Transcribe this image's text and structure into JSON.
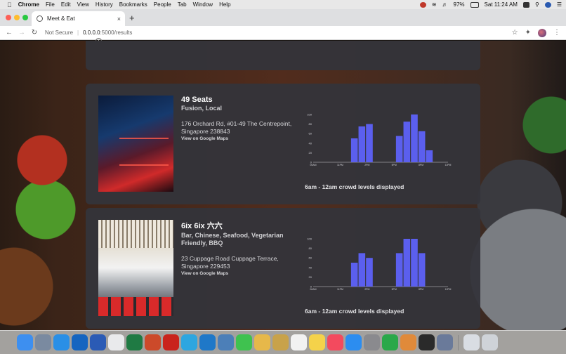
{
  "menubar": {
    "app": "Chrome",
    "items": [
      "File",
      "Edit",
      "View",
      "History",
      "Bookmarks",
      "People",
      "Tab",
      "Window",
      "Help"
    ],
    "battery": "97%",
    "datetime": "Sat 11:24 AM"
  },
  "tab": {
    "title": "Meet & Eat",
    "close": "×",
    "new_tab": "+"
  },
  "toolbar": {
    "security": "Not Secure",
    "url_host": "0.0.0.0",
    "url_path": ":5000/results"
  },
  "restaurants": [
    {
      "name": "49 Seats",
      "cuisine": "Fusion, Local",
      "address": "176 Orchard Rd, #01-49 The Centrepoint, Singapore 238843",
      "map_link": "View on Google Maps",
      "caption": "6am - 12am crowd levels displayed",
      "chart_data": {
        "type": "bar",
        "categories": [
          "6am",
          "7am",
          "8am",
          "9am",
          "10am",
          "11am",
          "12pm",
          "1pm",
          "2pm",
          "3pm",
          "4pm",
          "5pm",
          "6pm",
          "7pm",
          "8pm",
          "9pm",
          "10pm",
          "11pm"
        ],
        "values": [
          0,
          0,
          0,
          0,
          0,
          50,
          75,
          80,
          0,
          0,
          0,
          55,
          85,
          100,
          65,
          25,
          0,
          0
        ],
        "ylim": [
          0,
          100
        ],
        "yticks": [
          "0",
          "20",
          "40",
          "60",
          "80",
          "100"
        ],
        "xticks": [
          "06AM",
          "11PM",
          "2PM",
          "5PM",
          "8PM",
          "11PM"
        ],
        "bar_color": "#5b5fee"
      }
    },
    {
      "name": "6ix 6ix 六六",
      "cuisine": "Bar, Chinese, Seafood, Vegetarian Friendly, BBQ",
      "address": "23 Cuppage Road Cuppage Terrace, Singapore 229453",
      "map_link": "View on Google Maps",
      "caption": "6am - 12am crowd levels displayed",
      "chart_data": {
        "type": "bar",
        "categories": [
          "6am",
          "7am",
          "8am",
          "9am",
          "10am",
          "11am",
          "12pm",
          "1pm",
          "2pm",
          "3pm",
          "4pm",
          "5pm",
          "6pm",
          "7pm",
          "8pm",
          "9pm",
          "10pm",
          "11pm"
        ],
        "values": [
          0,
          0,
          0,
          0,
          0,
          50,
          70,
          60,
          0,
          0,
          0,
          70,
          100,
          100,
          70,
          0,
          0,
          0
        ],
        "ylim": [
          0,
          100
        ],
        "yticks": [
          "0",
          "20",
          "40",
          "60",
          "80",
          "100"
        ],
        "xticks": [
          "06AM",
          "11PM",
          "2PM",
          "5PM",
          "8PM",
          "11PM"
        ],
        "bar_color": "#5b5fee"
      }
    }
  ],
  "dock": {
    "apps": [
      {
        "name": "finder",
        "color": "#3d8ff0"
      },
      {
        "name": "launchpad",
        "color": "#7a8aa0"
      },
      {
        "name": "safari",
        "color": "#2a8fe6"
      },
      {
        "name": "outlook",
        "color": "#1565c0"
      },
      {
        "name": "word",
        "color": "#2b5bb5"
      },
      {
        "name": "chrome",
        "color": "#e9eaec"
      },
      {
        "name": "excel",
        "color": "#1f7a43"
      },
      {
        "name": "powerpoint",
        "color": "#cc4a2a"
      },
      {
        "name": "acrobat",
        "color": "#c9231c"
      },
      {
        "name": "telegram",
        "color": "#2ea6e0"
      },
      {
        "name": "vscode",
        "color": "#1f78c8"
      },
      {
        "name": "preview",
        "color": "#4c7fb8"
      },
      {
        "name": "messages",
        "color": "#3fc24f"
      },
      {
        "name": "photos",
        "color": "#e6b84a"
      },
      {
        "name": "notes-app",
        "color": "#c8a24a"
      },
      {
        "name": "calendar",
        "color": "#f2f2f2"
      },
      {
        "name": "notes",
        "color": "#f4d24a"
      },
      {
        "name": "music",
        "color": "#f34a5e"
      },
      {
        "name": "app-store",
        "color": "#2c8df0"
      },
      {
        "name": "system-preferences",
        "color": "#8a8a8e"
      },
      {
        "name": "numbers",
        "color": "#2aa84a"
      },
      {
        "name": "kotlin",
        "color": "#e08a3a"
      },
      {
        "name": "terminal",
        "color": "#2a2a2a"
      },
      {
        "name": "quicktime",
        "color": "#6a7a9a"
      },
      {
        "name": "downloads",
        "color": "#d9dde3"
      },
      {
        "name": "trash",
        "color": "#cfd3d8"
      }
    ]
  }
}
